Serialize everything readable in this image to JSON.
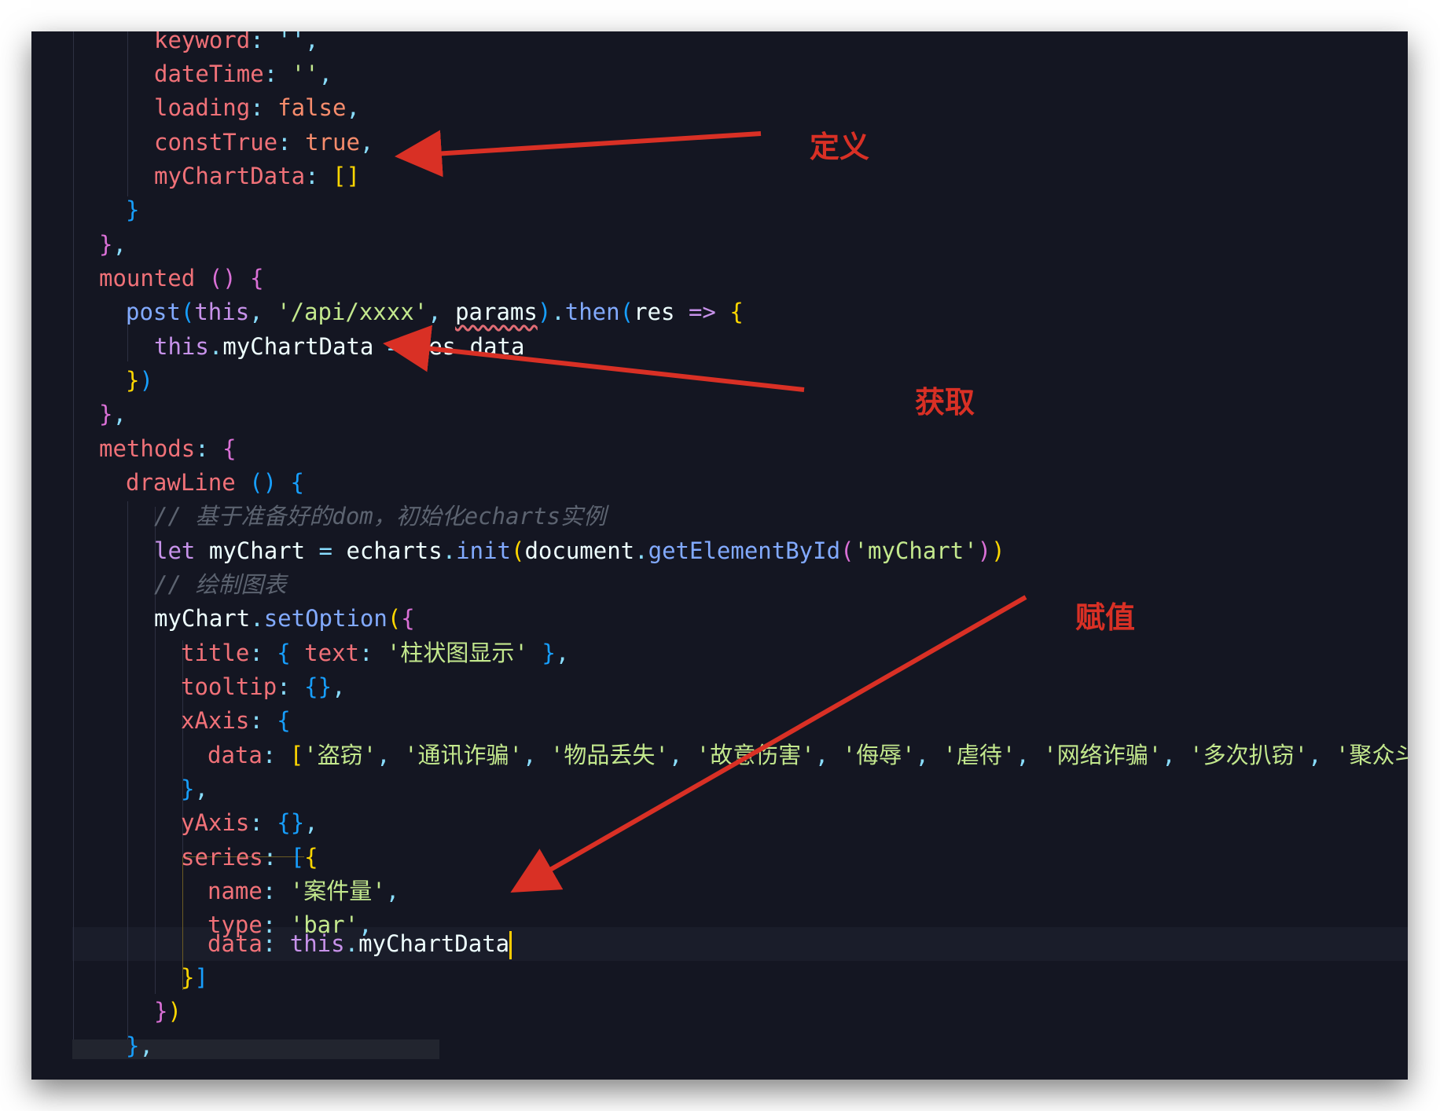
{
  "editor": {
    "lines": {
      "l0": {
        "prop": "keyword",
        "rest": ": '',"
      },
      "l1": {
        "prop": "dateTime",
        "rest": ": '',"
      },
      "l2": {
        "prop": "loading",
        "val": "false"
      },
      "l3": {
        "prop": "constTrue",
        "val": "true"
      },
      "l4": {
        "prop": "myChartData",
        "val": "[]"
      },
      "l7": {
        "kw": "mounted"
      },
      "l8": {
        "fn": "post",
        "this": "this",
        "str": "'/api/xxxx'",
        "param": "params",
        "then": "then",
        "arg": "res",
        "arrow": "=>"
      },
      "l9": {
        "this": "this",
        "lhs": "myChartData",
        "rhs_obj": "res",
        "rhs_prop": "data"
      },
      "l12": {
        "kw": "methods"
      },
      "l13": {
        "fn": "drawLine"
      },
      "l14": {
        "comment": "// 基于准备好的dom，初始化echarts实例"
      },
      "l15": {
        "let": "let",
        "var": "myChart",
        "obj": "echarts",
        "fn": "init",
        "doc": "document",
        "fn2": "getElementById",
        "str": "'myChart'"
      },
      "l16": {
        "comment": "// 绘制图表"
      },
      "l17": {
        "obj": "myChart",
        "fn": "setOption"
      },
      "l18": {
        "prop": "title",
        "prop2": "text",
        "str": "'柱状图显示'"
      },
      "l19": {
        "prop": "tooltip"
      },
      "l20": {
        "prop": "xAxis"
      },
      "l21": {
        "prop": "data",
        "items": [
          "'盗窃'",
          "'通讯诈骗'",
          "'物品丢失'",
          "'故意伤害'",
          "'侮辱'",
          "'虐待'",
          "'网络诈骗'",
          "'多次扒窃'",
          "'聚众斗"
        ]
      },
      "l23": {
        "prop": "yAxis"
      },
      "l24": {
        "prop": "series"
      },
      "l25": {
        "prop": "name",
        "str": "'案件量'"
      },
      "l26": {
        "prop": "type",
        "str": "'bar'"
      },
      "l27": {
        "prop": "data",
        "this": "this",
        "val": "myChartData"
      }
    }
  },
  "annotations": {
    "define": "定义",
    "fetch": "获取",
    "assign": "赋值"
  },
  "colors": {
    "background": "#141622",
    "annotation": "#d93025"
  }
}
